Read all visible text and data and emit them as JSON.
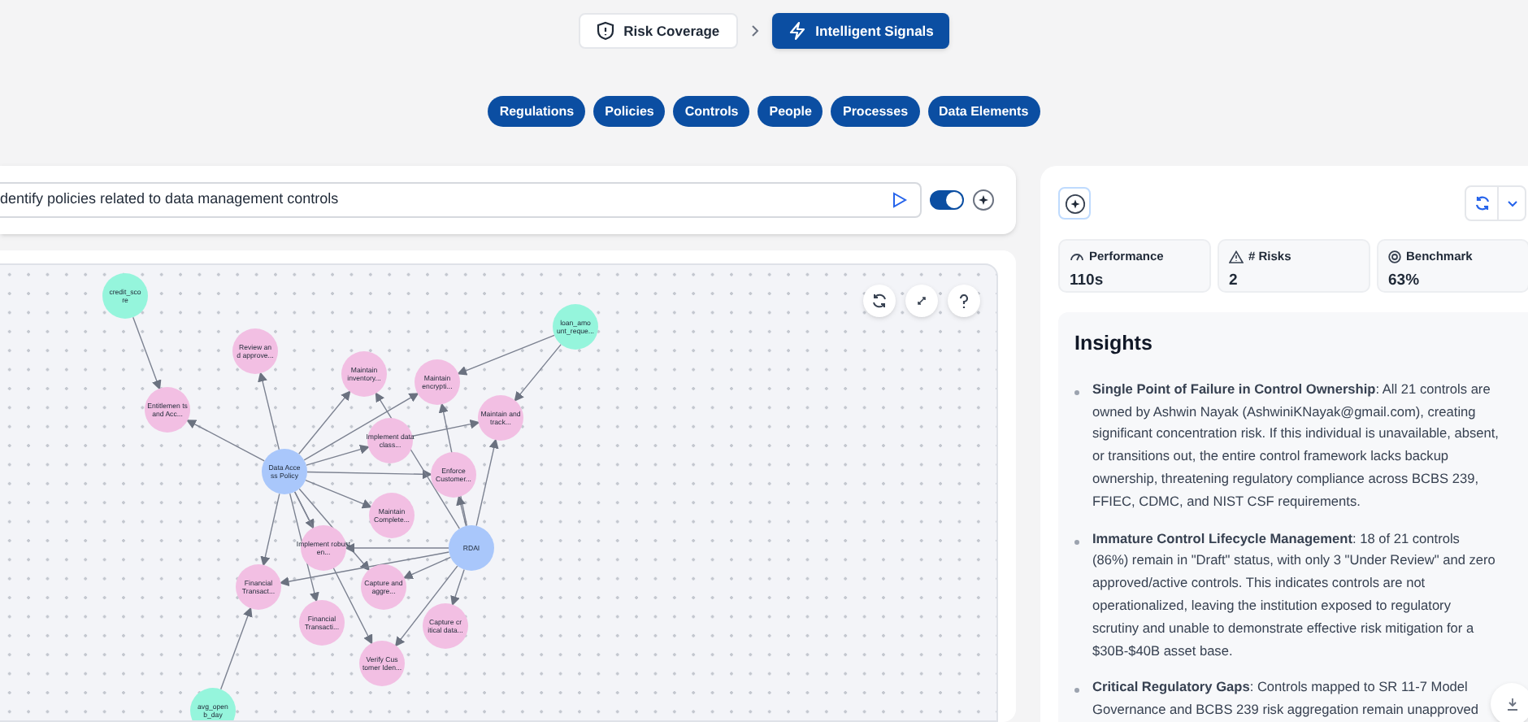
{
  "nav": {
    "tabs": [
      {
        "label": "Risk Coverage",
        "selected": false
      },
      {
        "label": "Intelligent Signals",
        "selected": true
      }
    ]
  },
  "filters": [
    "Regulations",
    "Policies",
    "Controls",
    "People",
    "Processes",
    "Data Elements"
  ],
  "query": {
    "value": "dentify policies related to data management controls",
    "toggle_on": true
  },
  "graph": {
    "nodes": [
      {
        "kind": "data",
        "label": "credit_sco re"
      },
      {
        "kind": "control",
        "label": "Entitlemen ts and Acc..."
      },
      {
        "kind": "control",
        "label": "Review an d approve..."
      },
      {
        "kind": "control",
        "label": "Maintain inventory..."
      },
      {
        "kind": "control",
        "label": "Maintain encrypti..."
      },
      {
        "kind": "control",
        "label": "Maintain and track..."
      },
      {
        "kind": "control",
        "label": "Implement data class..."
      },
      {
        "kind": "policy",
        "label": "Data Acce ss Policy"
      },
      {
        "kind": "control",
        "label": "Enforce Customer..."
      },
      {
        "kind": "control",
        "label": "Maintain Complete..."
      },
      {
        "kind": "control",
        "label": "Implement robust en..."
      },
      {
        "kind": "policy",
        "label": "RDAI"
      },
      {
        "kind": "control",
        "label": "Financial Transact..."
      },
      {
        "kind": "control",
        "label": "Capture and aggre..."
      },
      {
        "kind": "control",
        "label": "Financial Transacti..."
      },
      {
        "kind": "control",
        "label": "Capture cr itical data..."
      },
      {
        "kind": "control",
        "label": "Verify Cus tomer Iden..."
      },
      {
        "kind": "data",
        "label": "avg_open b_day"
      },
      {
        "kind": "data",
        "label": "loan_amo unt_reque..."
      }
    ]
  },
  "stats": [
    {
      "label": "Performance",
      "value": "110s"
    },
    {
      "label": "# Risks",
      "value": "2"
    },
    {
      "label": "Benchmark",
      "value": "63%"
    }
  ],
  "insights": {
    "title": "Insights",
    "items": [
      "**Single Point of Failure in Control Ownership**: All 21 controls are owned by Ashwin Nayak (AshwiniKNayak@gmail.com), creating significant concentration risk. If this individual is unavailable, absent, or transitions out, the entire control framework lacks backup ownership, threatening regulatory compliance across BCBS 239, FFIEC, CDMC, and NIST CSF requirements.",
      "**Immature Control Lifecycle Management**: 18 of 21 controls (86%) remain in \"Draft\" status, with only 3 \"Under Review\" and zero approved/active controls. This indicates controls are not operationalized, leaving the institution exposed to regulatory scrutiny and unable to demonstrate effective risk mitigation for a $30B-$40B asset base.",
      "**Critical Regulatory Gaps**: Controls mapped to SR 11-7 Model Governance and BCBS 239 risk aggregation remain unapproved"
    ]
  }
}
